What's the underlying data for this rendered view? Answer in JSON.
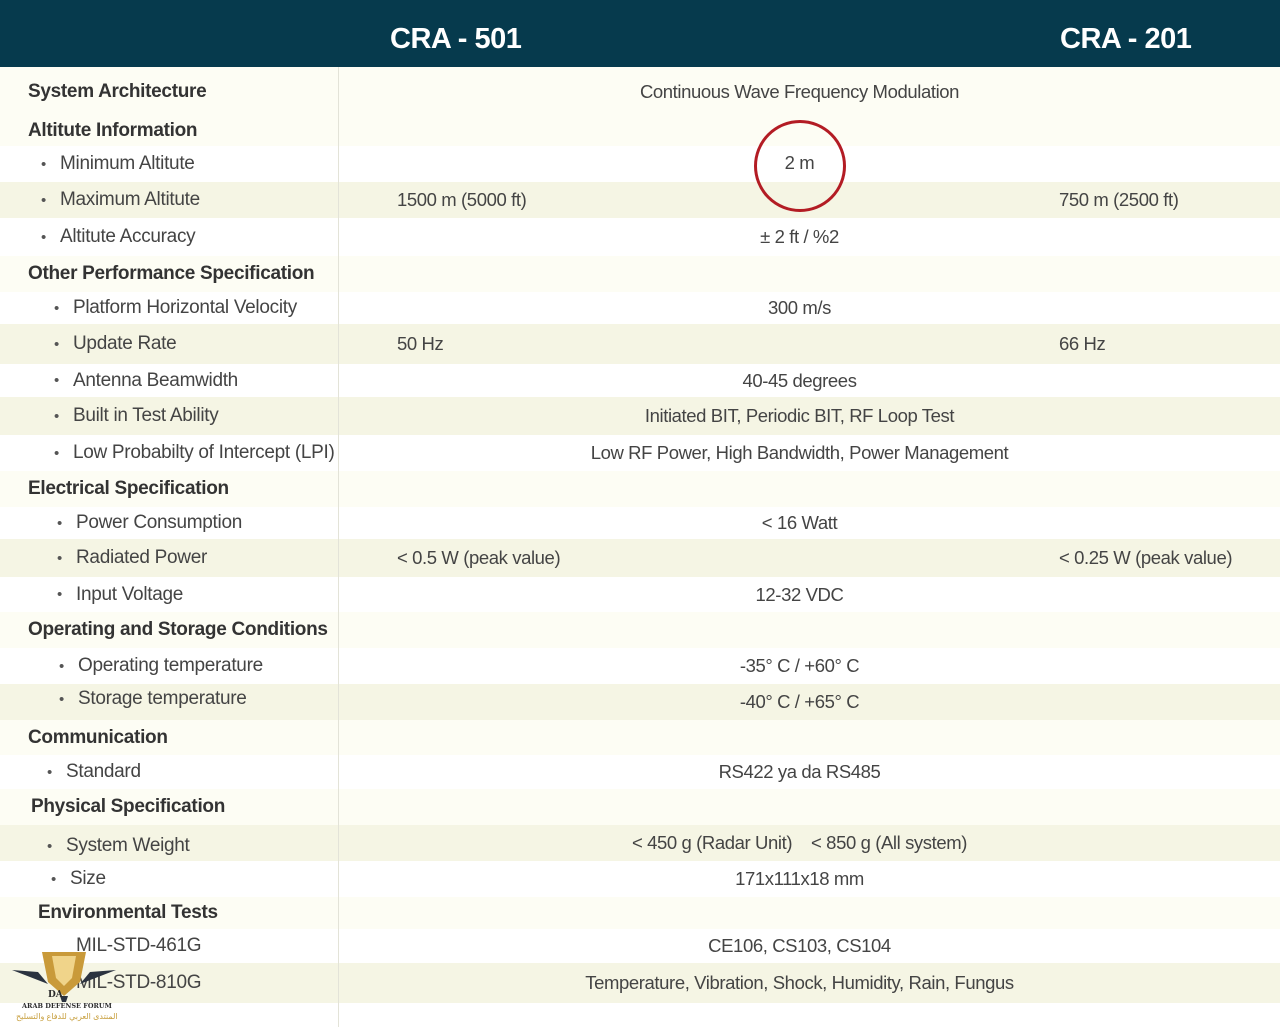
{
  "header": {
    "col1": "CRA - 501",
    "col2": "CRA - 201"
  },
  "rows": {
    "system_architecture": {
      "label": "System Architecture",
      "value": "Continuous Wave Frequency Modulation"
    },
    "altitude_info": {
      "label": "Altitute Information"
    },
    "min_altitude": {
      "label": "Minimum Altitute",
      "value": "2 m"
    },
    "max_altitude": {
      "label": "Maximum Altitute",
      "value_501": "1500 m  (5000 ft)",
      "value_201": "750 m  (2500 ft)"
    },
    "altitude_accuracy": {
      "label": "Altitute Accuracy",
      "value": "± 2 ft / %2"
    },
    "other_perf": {
      "label": "Other Performance Specification"
    },
    "horizontal_velocity": {
      "label": "Platform Horizontal Velocity",
      "value": "300 m/s"
    },
    "update_rate": {
      "label": "Update Rate",
      "value_501": "50 Hz",
      "value_201": "66 Hz"
    },
    "antenna_beamwidth": {
      "label": "Antenna Beamwidth",
      "value": "40-45 degrees"
    },
    "built_in_test": {
      "label": "Built in Test Ability",
      "value": "Initiated BIT, Periodic BIT, RF Loop Test"
    },
    "lpi": {
      "label": "Low Probabilty of Intercept (LPI)",
      "value": "Low RF Power, High Bandwidth, Power Management"
    },
    "electrical": {
      "label": "Electrical Specification"
    },
    "power_consumption": {
      "label": "Power Consumption",
      "value": "< 16 Watt"
    },
    "radiated_power": {
      "label": "Radiated Power",
      "value_501": "< 0.5 W (peak value)",
      "value_201": "< 0.25 W (peak value)"
    },
    "input_voltage": {
      "label": "Input Voltage",
      "value": "12-32 VDC"
    },
    "operating_storage": {
      "label": "Operating and Storage Conditions"
    },
    "operating_temp": {
      "label": "Operating temperature",
      "value": "-35° C / +60° C"
    },
    "storage_temp": {
      "label": "Storage temperature",
      "value": "-40° C / +65° C"
    },
    "communication": {
      "label": "Communication"
    },
    "standard": {
      "label": "Standard",
      "value": "RS422 ya da RS485"
    },
    "physical": {
      "label": "Physical Specification"
    },
    "system_weight": {
      "label": "System Weight",
      "value": "< 450 g (Radar Unit)    < 850 g (All system)"
    },
    "size": {
      "label": "Size",
      "value": "171x111x18 mm"
    },
    "environmental": {
      "label": "Environmental Tests"
    },
    "mil_461": {
      "label": "MIL-STD-461G",
      "value": "CE106, CS103, CS104"
    },
    "mil_810": {
      "label": "MIL-STD-810G",
      "value": "Temperature, Vibration, Shock, Humidity, Rain, Fungus"
    }
  },
  "watermark": {
    "badge": "DA",
    "name": "ARAB DEFENSE FORUM",
    "arabic": "المنتدى العربي للدفاع والتسليح"
  },
  "colors": {
    "header_bg": "#063a4d",
    "highlight_circle": "#b31c24"
  }
}
